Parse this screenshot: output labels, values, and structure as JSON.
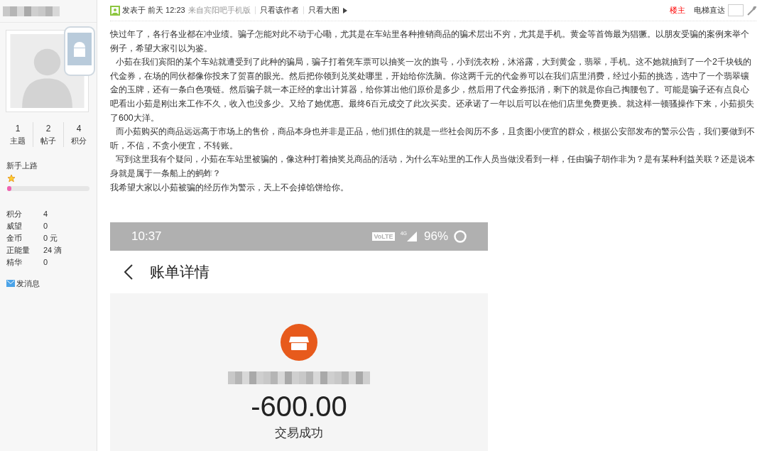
{
  "user": {
    "stats": [
      {
        "value": "1",
        "label": "主题"
      },
      {
        "value": "2",
        "label": "帖子"
      },
      {
        "value": "4",
        "label": "积分"
      }
    ],
    "rank": "新手上路",
    "progress": {
      "level": 0.05
    },
    "profile": [
      {
        "label": "积分",
        "value": "4"
      },
      {
        "label": "威望",
        "value": "0"
      },
      {
        "label": "金币",
        "value": "0 元"
      },
      {
        "label": "正能量",
        "value": "24 滴"
      },
      {
        "label": "精华",
        "value": "0"
      }
    ],
    "message_link": "发消息"
  },
  "post_header": {
    "posted": "发表于 前天 12:23",
    "source": "来自宾阳吧手机版",
    "links": [
      "只看该作者",
      "只看大图"
    ],
    "floor": "楼主",
    "jump_label": "电梯直达"
  },
  "paragraphs": [
    {
      "text": "快过年了，各行各业都在冲业绩。骗子怎能对此不动于心嘞，尤其是在车站里各种推销商品的骗术层出不穷，尤其是手机。黄金等首饰最为猖獗。以朋友受骗的案例来举个例子，希望大家引以为鉴。",
      "indent": false
    },
    {
      "text": "小茹在我们宾阳的某个车站就遭受到了此种的骗局，骗子打着凭车票可以抽奖一次的旗号，小到洗衣粉，沐浴露，大到黄金，翡翠，手机。这不她就抽到了一个2千块钱的代金券，在场的同伙都像你投来了贺喜的眼光。然后把你领到兑奖处哪里，开始给你洗脑。你这两千元的代金券可以在我们店里消费，经过小茹的挑选，选中了一个翡翠镶金的玉牌，还有一条白色项链。然后骗子就一本正经的拿出计算器，给你算出他们原价是多少，然后用了代金券抵消，剩下的就是你自己掏腰包了。可能是骗子还有点良心吧看出小茹是刚出来工作不久，收入也没多少。又给了她优惠。最终6百元成交了此次买卖。还承诺了一年以后可以在他们店里免费更换。就这样一顿骚操作下来，小茹损失了600大洋。",
      "indent": true
    },
    {
      "text": "而小茹购买的商品远远高于市场上的售价，商品本身也并非是正品，他们抓住的就是一些社会阅历不多，且贪图小便宜的群众，根据公安部发布的警示公告，我们要做到不听，不信，不贪小便宜，不转账。",
      "indent": true
    },
    {
      "text": "写到这里我有个疑问，小茹在车站里被骗的，像这种打着抽奖兑商品的活动，为什么车站里的工作人员当做没看到一样，任由骗子胡作非为？是有某种利益关联？还是说本身就是属于一条船上的蚂蚱？",
      "indent": true
    },
    {
      "text": "我希望大家以小茹被骗的经历作为警示，天上不会掉馅饼给你。",
      "indent": false
    }
  ],
  "screenshot": {
    "time": "10:37",
    "volte": "VoLTE",
    "network": "4G",
    "battery": "96%",
    "title": "账单详情",
    "amount": "-600.00",
    "status": "交易成功"
  }
}
